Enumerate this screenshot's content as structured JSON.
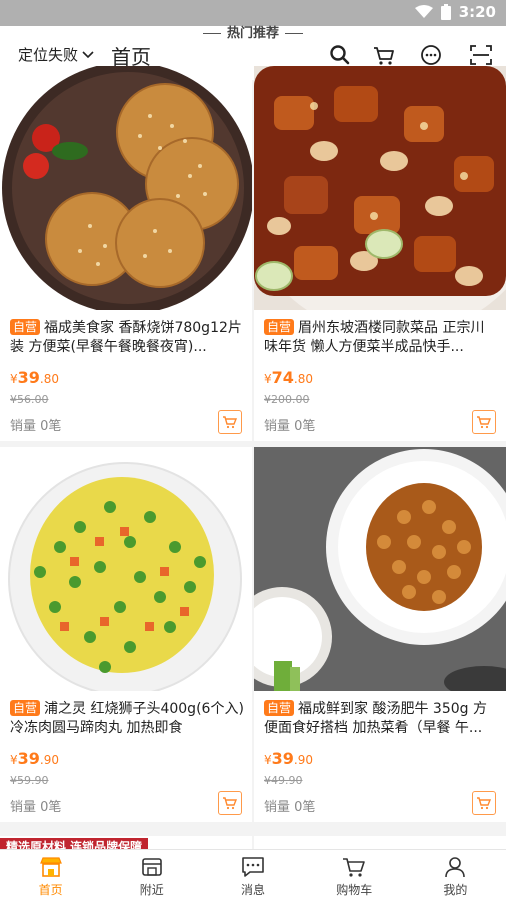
{
  "status_bar": {
    "time": "3:20"
  },
  "header": {
    "hot_label": "热门推荐",
    "location": "定位失败",
    "title": "首页"
  },
  "products": [
    {
      "tag": "自营",
      "name": "福成美食家 香酥烧饼780g12片装 方便菜(早餐午餐晚餐夜宵)...",
      "price_symbol": "¥",
      "price_int": "39",
      "price_dec": ".80",
      "original_price": "¥56.00",
      "sales": "销量 0笔"
    },
    {
      "tag": "自营",
      "name": "眉州东坡酒楼同款菜品 正宗川味年货 懒人方便菜半成品快手...",
      "price_symbol": "¥",
      "price_int": "74",
      "price_dec": ".80",
      "original_price": "¥200.00",
      "sales": "销量 0笔"
    },
    {
      "tag": "自营",
      "name": "浦之灵 红烧狮子头400g(6个入) 冷冻肉圆马蹄肉丸 加热即食",
      "price_symbol": "¥",
      "price_int": "39",
      "price_dec": ".90",
      "original_price": "¥59.90",
      "sales": "销量 0笔"
    },
    {
      "tag": "自营",
      "name": "福成鲜到家 酸汤肥牛 350g 方便面食好搭档 加热菜肴（早餐 午...",
      "price_symbol": "¥",
      "price_int": "39",
      "price_dec": ".90",
      "original_price": "¥49.90",
      "sales": "销量 0笔"
    }
  ],
  "partial_banner": "精选原材料 连锁品牌保障",
  "tabs": [
    {
      "label": "首页",
      "icon": "shop-icon"
    },
    {
      "label": "附近",
      "icon": "nearby-icon"
    },
    {
      "label": "消息",
      "icon": "message-icon"
    },
    {
      "label": "购物车",
      "icon": "cart-icon"
    },
    {
      "label": "我的",
      "icon": "profile-icon"
    }
  ],
  "colors": {
    "accent": "#ff7a1a",
    "active_tab": "#ff8a00"
  }
}
